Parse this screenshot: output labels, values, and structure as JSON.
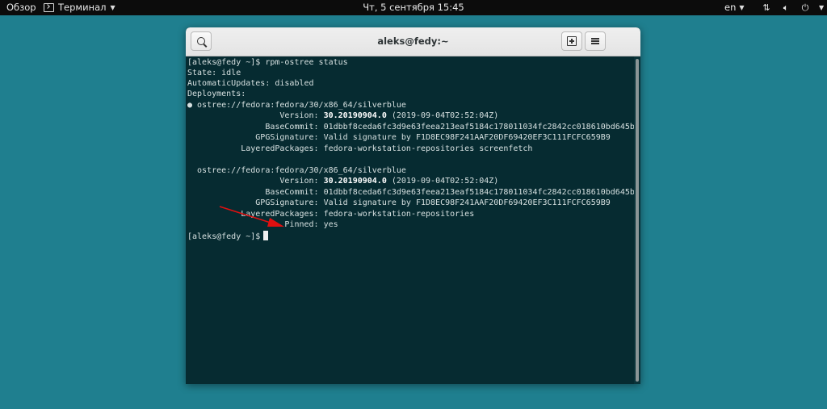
{
  "topbar": {
    "activities": "Обзор",
    "app_name": "Терминал",
    "clock": "Чт, 5 сентября  15:45",
    "lang": "en"
  },
  "window": {
    "title": "aleks@fedy:~"
  },
  "terminal": {
    "prompt": "[aleks@fedy ~]$",
    "command": " rpm-ostree status",
    "lines": {
      "state": "State: idle",
      "auto": "AutomaticUpdates: disabled",
      "deployments": "Deployments:",
      "d1_ref": "● ostree://fedora:fedora/30/x86_64/silverblue",
      "d1_version_label": "                   Version: ",
      "d1_version_num": "30.20190904.0",
      "d1_version_rest": " (2019-09-04T02:52:04Z)",
      "d1_commit": "                BaseCommit: 01dbbf8ceda6fc3d9e63feea213eaf5184c178011034fc2842cc018610bd645b",
      "d1_gpg": "              GPGSignature: Valid signature by F1D8EC98F241AAF20DF69420EF3C111FCFC659B9",
      "d1_layered": "           LayeredPackages: fedora-workstation-repositories screenfetch",
      "d2_ref": "  ostree://fedora:fedora/30/x86_64/silverblue",
      "d2_version_label": "                   Version: ",
      "d2_version_num": "30.20190904.0",
      "d2_version_rest": " (2019-09-04T02:52:04Z)",
      "d2_commit": "                BaseCommit: 01dbbf8ceda6fc3d9e63feea213eaf5184c178011034fc2842cc018610bd645b",
      "d2_gpg": "              GPGSignature: Valid signature by F1D8EC98F241AAF20DF69420EF3C111FCFC659B9",
      "d2_layered": "           LayeredPackages: fedora-workstation-repositories",
      "d2_pinned": "                    Pinned: yes"
    },
    "final_prompt": "[aleks@fedy ~]$"
  },
  "colors": {
    "desktop": "#1f7f8f",
    "terminal_bg": "#062b31",
    "annotation_arrow": "#e01010"
  },
  "icons": {
    "app_icon": "terminal-icon",
    "search": "search-icon",
    "new_tab": "new-tab-icon",
    "menu": "hamburger-menu-icon",
    "close": "close-icon"
  }
}
